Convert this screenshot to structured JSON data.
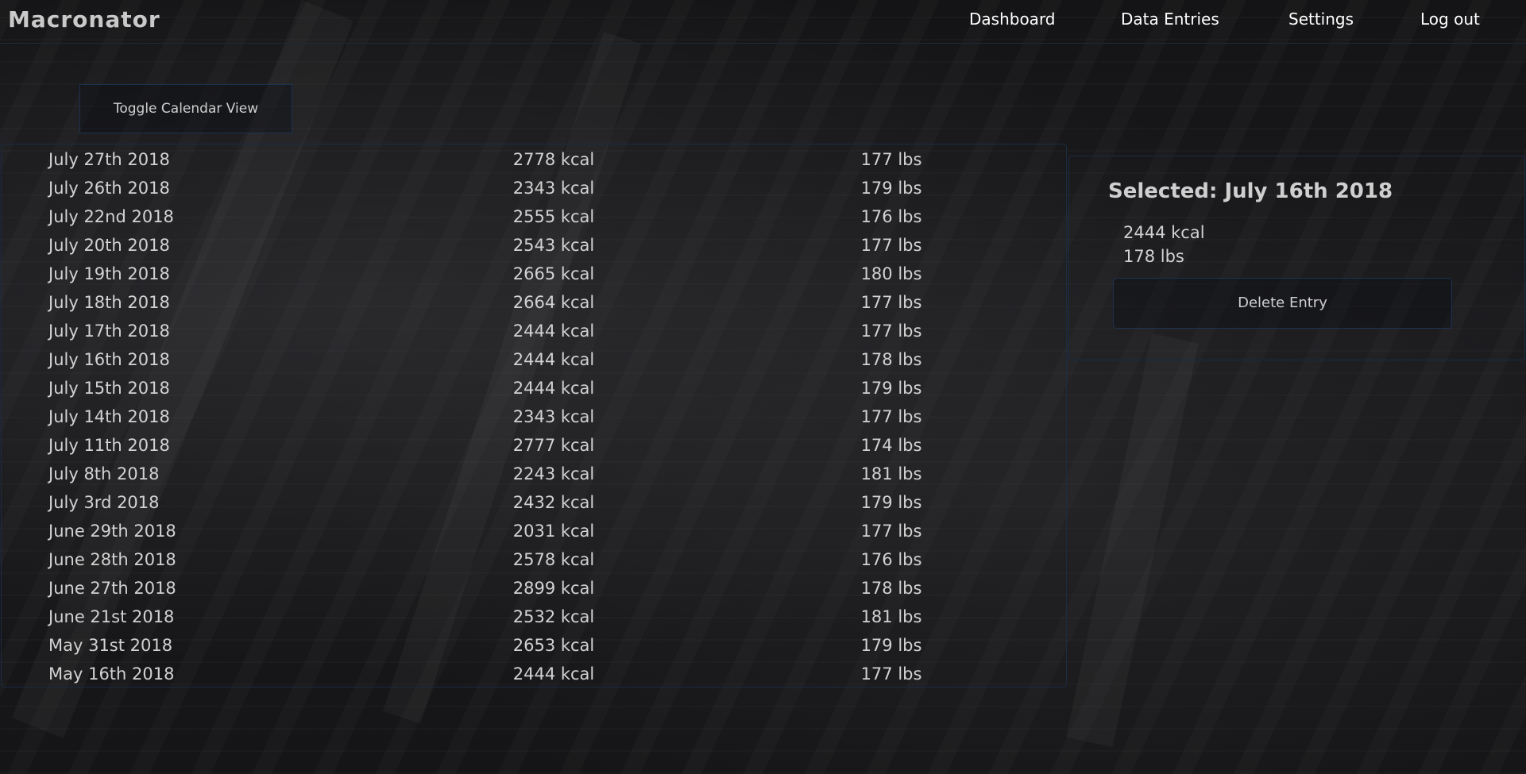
{
  "app": {
    "title": "Macronator"
  },
  "nav": {
    "items": [
      {
        "label": "Dashboard"
      },
      {
        "label": "Data Entries"
      },
      {
        "label": "Settings"
      },
      {
        "label": "Log out"
      }
    ]
  },
  "toolbar": {
    "toggle_calendar_label": "Toggle Calendar View"
  },
  "entries": [
    {
      "date": "July 27th 2018",
      "kcal": "2778 kcal",
      "weight": "177 lbs"
    },
    {
      "date": "July 26th 2018",
      "kcal": "2343 kcal",
      "weight": "179 lbs"
    },
    {
      "date": "July 22nd 2018",
      "kcal": "2555 kcal",
      "weight": "176 lbs"
    },
    {
      "date": "July 20th 2018",
      "kcal": "2543 kcal",
      "weight": "177 lbs"
    },
    {
      "date": "July 19th 2018",
      "kcal": "2665 kcal",
      "weight": "180 lbs"
    },
    {
      "date": "July 18th 2018",
      "kcal": "2664 kcal",
      "weight": "177 lbs"
    },
    {
      "date": "July 17th 2018",
      "kcal": "2444 kcal",
      "weight": "177 lbs"
    },
    {
      "date": "July 16th 2018",
      "kcal": "2444 kcal",
      "weight": "178 lbs"
    },
    {
      "date": "July 15th 2018",
      "kcal": "2444 kcal",
      "weight": "179 lbs"
    },
    {
      "date": "July 14th 2018",
      "kcal": "2343 kcal",
      "weight": "177 lbs"
    },
    {
      "date": "July 11th 2018",
      "kcal": "2777 kcal",
      "weight": "174 lbs"
    },
    {
      "date": "July 8th 2018",
      "kcal": "2243 kcal",
      "weight": "181 lbs"
    },
    {
      "date": "July 3rd 2018",
      "kcal": "2432 kcal",
      "weight": "179 lbs"
    },
    {
      "date": "June 29th 2018",
      "kcal": "2031 kcal",
      "weight": "177 lbs"
    },
    {
      "date": "June 28th 2018",
      "kcal": "2578 kcal",
      "weight": "176 lbs"
    },
    {
      "date": "June 27th 2018",
      "kcal": "2899 kcal",
      "weight": "178 lbs"
    },
    {
      "date": "June 21st 2018",
      "kcal": "2532 kcal",
      "weight": "181 lbs"
    },
    {
      "date": "May 31st 2018",
      "kcal": "2653 kcal",
      "weight": "179 lbs"
    },
    {
      "date": "May 16th 2018",
      "kcal": "2444 kcal",
      "weight": "177 lbs"
    }
  ],
  "selected": {
    "title": "Selected: July 16th 2018",
    "kcal": "2444 kcal",
    "weight": "178 lbs",
    "delete_label": "Delete Entry"
  },
  "colors": {
    "border_accent": "#1b2c42",
    "text_primary": "#d2d2d2",
    "nav_text": "#ffffff"
  }
}
